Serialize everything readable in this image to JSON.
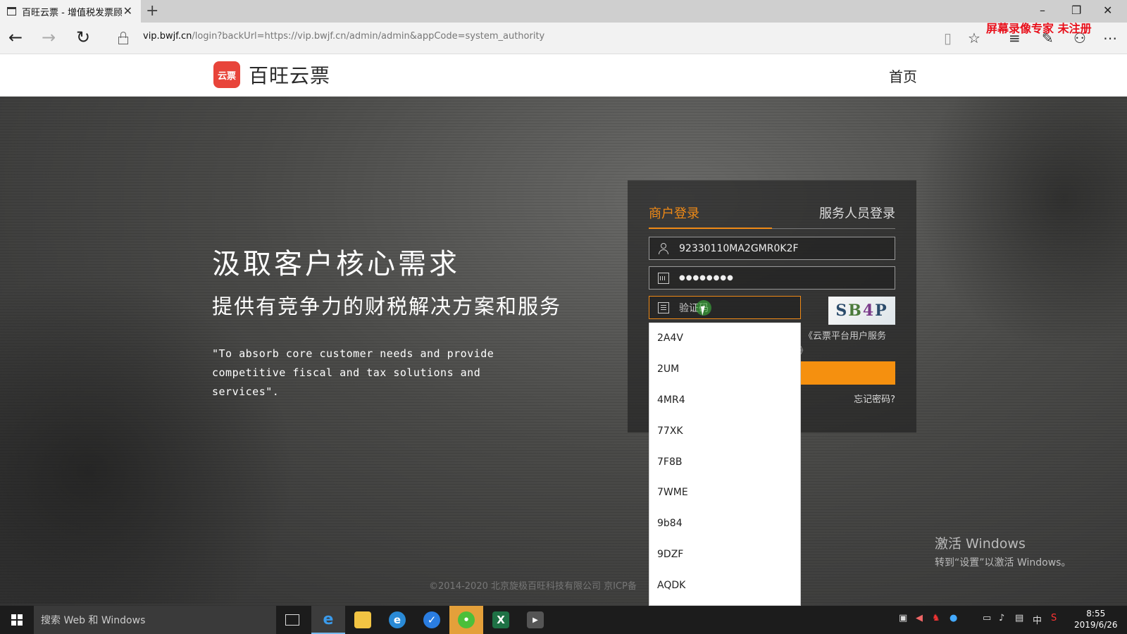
{
  "browser": {
    "tab_title": "百旺云票 - 增值税发票顾",
    "close_glyph": "✕",
    "new_tab_glyph": "+",
    "url_host": "vip.bwjf.cn",
    "url_path": "/login?backUrl=https://vip.bwjf.cn/admin/admin&appCode=system_authority",
    "recorder_watermark": "屏幕录像专家  未注册"
  },
  "site": {
    "logo_badge": "云票",
    "logo_text": "百旺云票",
    "nav_home": "首页"
  },
  "hero": {
    "headline": "汲取客户核心需求",
    "subheadline": "提供有竞争力的财税解决方案和服务",
    "quote": "\"To absorb core customer needs and provide competitive fiscal and tax solutions and services\".",
    "copyright": "©2014-2020 北京旋极百旺科技有限公司 京ICP备"
  },
  "login": {
    "tab_merchant": "商户登录",
    "tab_staff": "服务人员登录",
    "username_value": "92330110MA2GMR0K2F",
    "password_value": "●●●●●●●●",
    "captcha_placeholder": "验证码",
    "captcha_chars": [
      "S",
      "B",
      "4",
      "P"
    ],
    "agreement_text": "《云票平台用户服务",
    "agreement_tail": "》",
    "forgot_password": "忘记密码?",
    "accent_color": "#f08a16"
  },
  "autocomplete": {
    "options": [
      "2A4V",
      "2UM",
      "4MR4",
      "77XK",
      "7F8B",
      "7WME",
      "9b84",
      "9DZF",
      "AQDK"
    ]
  },
  "activation": {
    "title": "激活 Windows",
    "subtitle": "转到“设置”以激活 Windows。"
  },
  "taskbar": {
    "search_placeholder": "搜索 Web 和 Windows",
    "ime_indicator": "中",
    "clock_time": "8:55",
    "clock_date": "2019/6/26"
  }
}
